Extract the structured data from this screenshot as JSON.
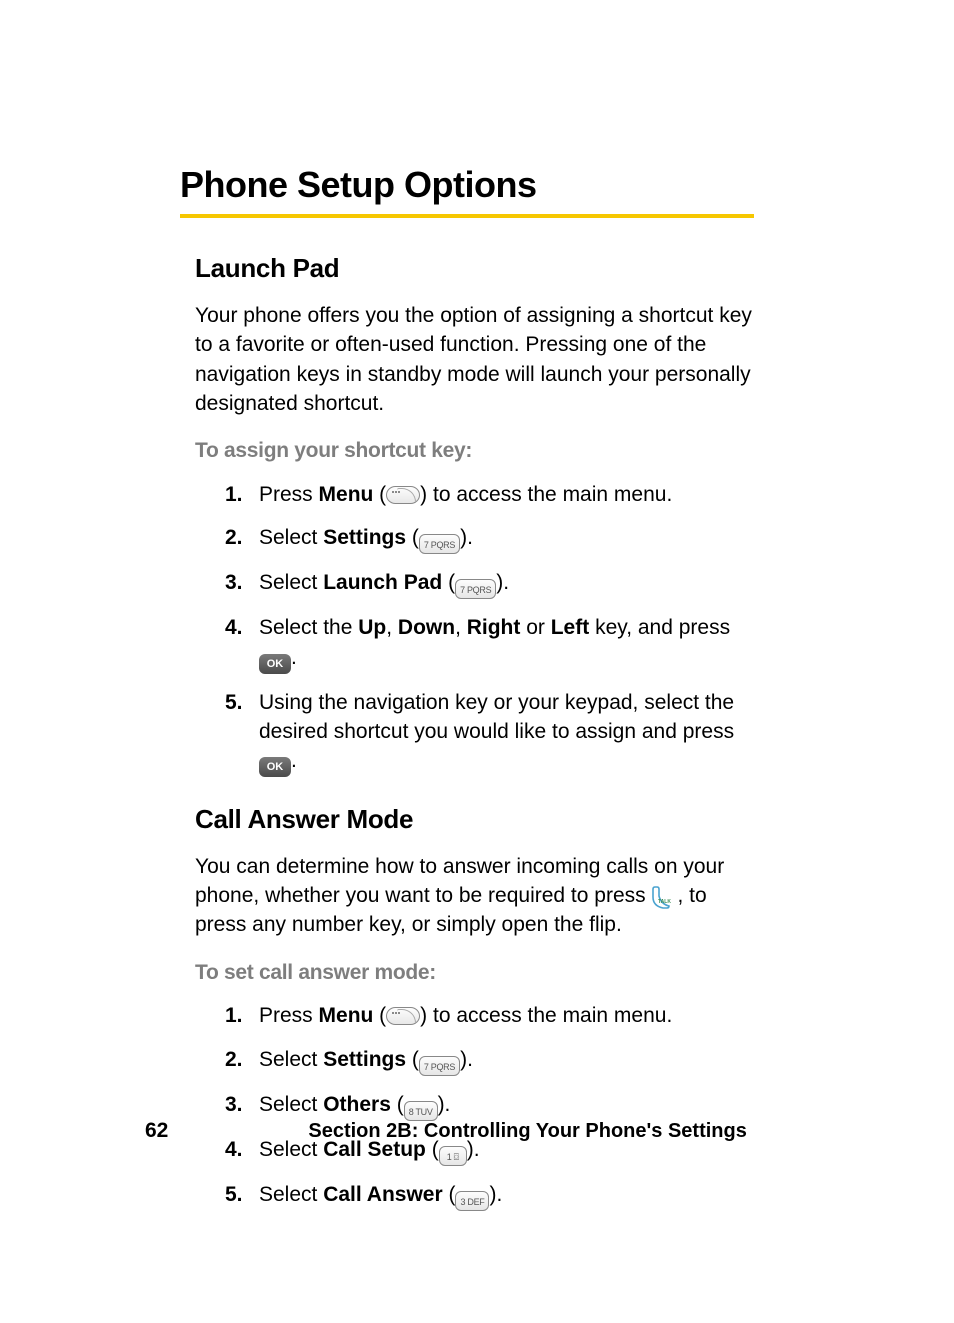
{
  "page_number": "62",
  "footer_text": "Section 2B: Controlling Your Phone's Settings",
  "heading": "Phone Setup Options",
  "launch_pad": {
    "title": "Launch Pad",
    "intro": "Your phone offers you the option of assigning a shortcut key to a favorite or often-used function. Pressing one of the navigation keys in standby mode will launch your personally designated shortcut.",
    "lead": "To assign your shortcut key:",
    "steps": [
      {
        "pre": "Press ",
        "bold1": "Menu",
        "post1": " (",
        "icon1": "menu-key",
        "post2": ") to access the main menu."
      },
      {
        "pre": "Select ",
        "bold1": "Settings",
        "post1": " (",
        "icon1": "key-7pqrs",
        "post2": ")."
      },
      {
        "pre": "Select ",
        "bold1": "Launch Pad",
        "post1": " (",
        "icon1": "key-7pqrs",
        "post2": ")."
      },
      {
        "pre": "Select the ",
        "bold1": "Up",
        "mid1": ", ",
        "bold2": "Down",
        "mid2": ", ",
        "bold3": "Right",
        "mid3": " or ",
        "bold4": "Left",
        "post1": " key, and press ",
        "icon1": "ok-key",
        "post2": "."
      },
      {
        "pre": "Using the navigation key or your keypad, select the desired shortcut you would like to assign and press ",
        "icon1": "ok-key",
        "post2": "."
      }
    ]
  },
  "call_answer": {
    "title": "Call Answer Mode",
    "intro_a": "You can determine how to answer incoming calls on your phone, whether you want to be required to press ",
    "intro_b": ", to press any number key, or simply open the flip.",
    "lead": "To set call answer mode:",
    "steps": [
      {
        "pre": "Press ",
        "bold1": "Menu",
        "post1": " (",
        "icon1": "menu-key",
        "post2": ") to access the main menu."
      },
      {
        "pre": "Select ",
        "bold1": "Settings",
        "post1": " (",
        "icon1": "key-7pqrs",
        "post2": ")."
      },
      {
        "pre": "Select ",
        "bold1": "Others",
        "post1": " (",
        "icon1": "key-8tuv",
        "post2": ")."
      },
      {
        "pre": "Select ",
        "bold1": "Call Setup",
        "post1": " (",
        "icon1": "key-1",
        "post2": ")."
      },
      {
        "pre": "Select ",
        "bold1": "Call Answer",
        "post1": " (",
        "icon1": "key-3def",
        "post2": ")."
      }
    ]
  },
  "key_labels": {
    "7pqrs": "7 PQRS",
    "8tuv": "8 TUV",
    "1": "1 ⌼",
    "3def": "3 DEF",
    "ok": "OK"
  }
}
